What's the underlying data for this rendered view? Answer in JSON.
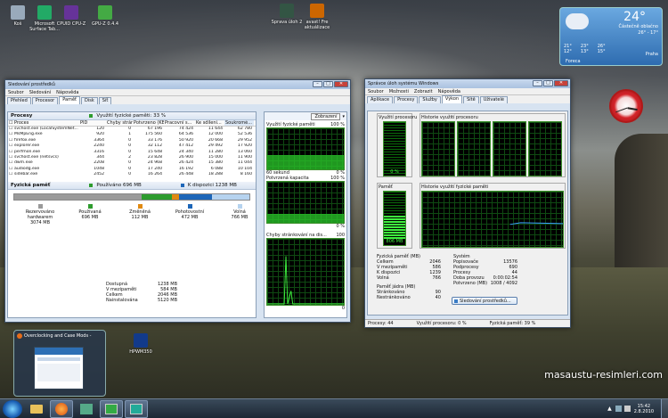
{
  "desktop": {
    "icons": [
      {
        "label": "Koš",
        "color": "#9ab"
      },
      {
        "label": "Microsoft Surface Tab...",
        "color": "#2a6"
      },
      {
        "label": "CPUID CPU-Z",
        "color": "#639"
      },
      {
        "label": "GPU-Z 0.4.4",
        "color": "#4a4"
      },
      {
        "label": "Sprava úloh 2",
        "color": "#354"
      },
      {
        "label": "avast! Fre aktuálizace",
        "color": "#c60"
      }
    ],
    "watermark": "masaustu-resimleri.com",
    "bottom_icon": "HPWM350"
  },
  "weather": {
    "temp": "24°",
    "desc": "Částečně oblačno",
    "range": "26° - 17°",
    "city": "Praha",
    "days": [
      {
        "d": "21°",
        "n": "12°"
      },
      {
        "d": "23°",
        "n": "13°"
      },
      {
        "d": "26°",
        "n": "15°"
      }
    ],
    "source": "Foreca"
  },
  "resmon": {
    "title": "Sledování prostředků",
    "menu": [
      "Soubor",
      "Sledování",
      "Nápověda"
    ],
    "tabs": [
      "Přehled",
      "Procesor",
      "Paměť",
      "Disk",
      "Síť"
    ],
    "processes_label": "Procesy",
    "usage_label": "Využití fyzické paměti: 33 %",
    "columns": [
      "Proces",
      "PID",
      "Chyby stránky",
      "Potvrzeno (KB)",
      "Pracovní s...",
      "Ke sdílení...",
      "Soukromé..."
    ],
    "rows": [
      [
        "svchost.exe (LocalSystemNet...",
        "120",
        "0",
        "67 196",
        "74 424",
        "11 644",
        "62 780"
      ],
      [
        "MsMpEng.exe",
        "920",
        "1",
        "175 560",
        "64 536",
        "12 000",
        "52 536"
      ],
      [
        "firefox.exe",
        "3364",
        "0",
        "33 176",
        "50 920",
        "20 668",
        "29 952"
      ],
      [
        "explorer.exe",
        "2240",
        "0",
        "32 112",
        "47 412",
        "29 492",
        "17 920"
      ],
      [
        "perfmon.exe",
        "3316",
        "0",
        "15 648",
        "24 340",
        "11 280",
        "13 060"
      ],
      [
        "svchost.exe (netsvcs)",
        "344",
        "2",
        "23 828",
        "26 900",
        "15 000",
        "11 900"
      ],
      [
        "dwm.exe",
        "2208",
        "0",
        "24 968",
        "26 424",
        "15 380",
        "11 044"
      ],
      [
        "audiodg.exe",
        "1048",
        "0",
        "17 240",
        "16 192",
        "6 088",
        "10 104"
      ],
      [
        "sidebar.exe",
        "2452",
        "0",
        "16 264",
        "26 448",
        "18 288",
        "8 160"
      ]
    ],
    "phys_label": "Fyzická paměť",
    "used_badge": "Používáno 696 MB",
    "avail_badge": "K dispozici 1238 MB",
    "legend": [
      {
        "label": "Rezervováno hardwarem",
        "val": "3074 MB",
        "color": "#9a9a9a"
      },
      {
        "label": "Používaná",
        "val": "696 MB",
        "color": "#2e9c2e"
      },
      {
        "label": "Změněná",
        "val": "112 MB",
        "color": "#e18a12"
      },
      {
        "label": "Pohotovostní",
        "val": "472 MB",
        "color": "#1d66b8"
      },
      {
        "label": "Volná",
        "val": "766 MB",
        "color": "#b6d3ef"
      }
    ],
    "stats": [
      {
        "k": "Dostupná",
        "v": "1238 MB"
      },
      {
        "k": "V mezipaměti",
        "v": "584 MB"
      },
      {
        "k": "Celkem",
        "v": "2046 MB"
      },
      {
        "k": "Nainstalována",
        "v": "5120 MB"
      }
    ],
    "view_btn": "Zobrazení",
    "graph_labels": {
      "g1": "Využití fyzické paměti",
      "g1p": "100 %",
      "g1b": "60 sekund",
      "g1z": "0 %",
      "g2": "Potvrzená kapacita",
      "g2p": "100 %",
      "g2z": "0 %",
      "g3": "Chyby stránkování na dis...",
      "g3p": "100",
      "g3z": "0"
    }
  },
  "taskmgr": {
    "title": "Správce úloh systému Windows",
    "menu": [
      "Soubor",
      "Možnosti",
      "Zobrazit",
      "Nápověda"
    ],
    "tabs": [
      "Aplikace",
      "Procesy",
      "Služby",
      "Výkon",
      "Sítě",
      "Uživatelé"
    ],
    "cpu_label": "Využití procesoru",
    "cpu_pct": "0 %",
    "cpu_hist": "Historie využití procesoru",
    "mem_label": "Paměť",
    "mem_val": "806 MB",
    "mem_hist": "Historie využití fyzické paměti",
    "phys_title": "Fyzická paměť (MB)",
    "phys": [
      {
        "k": "Celkem",
        "v": "2046"
      },
      {
        "k": "V mezipaměti",
        "v": "586"
      },
      {
        "k": "K dispozici",
        "v": "1239"
      },
      {
        "k": "Volná",
        "v": "766"
      }
    ],
    "kernel_title": "Paměť jádra (MB)",
    "kernel": [
      {
        "k": "Stránkováno",
        "v": "90"
      },
      {
        "k": "Nestránkováno",
        "v": "40"
      }
    ],
    "sys_title": "Systém",
    "sys": [
      {
        "k": "Popisovače",
        "v": "13576"
      },
      {
        "k": "Podprocesy",
        "v": "690"
      },
      {
        "k": "Procesy",
        "v": "44"
      },
      {
        "k": "Doba provozu",
        "v": "0:00:02:54"
      },
      {
        "k": "Potvrzeno (MB)",
        "v": "1008 / 4092"
      }
    ],
    "resmon_btn": "Sledování prostředků...",
    "status": [
      "Procesy: 44",
      "Využití procesoru: 0 %",
      "Fyzická paměť: 39 %"
    ]
  },
  "thumb": {
    "title": "Overclocking and Case Mods -"
  },
  "taskbar": {
    "time": "15:42",
    "date": "2.8.2010"
  }
}
